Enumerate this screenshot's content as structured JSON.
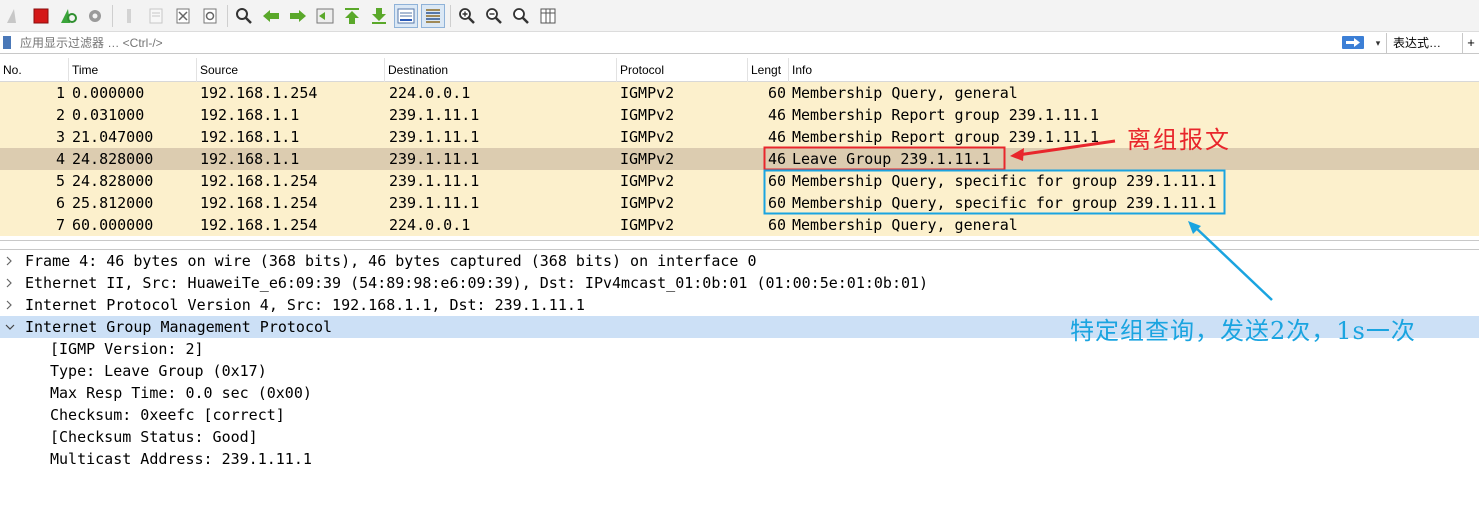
{
  "filter": {
    "placeholder": "应用显示过滤器 … <Ctrl-/>",
    "expression_label": "表达式…",
    "add_label": "+"
  },
  "toolbar": {
    "icons": [
      "shark-fin-start-icon",
      "stop-icon",
      "restart-icon",
      "options-gear-icon",
      "open-file-icon",
      "save-file-icon",
      "close-file-icon",
      "reload-icon",
      "find-icon",
      "go-back-icon",
      "go-forward-icon",
      "go-to-packet-icon",
      "first-packet-icon",
      "last-packet-icon",
      "autoscroll-icon",
      "colorize-icon",
      "zoom-in-icon",
      "zoom-out-icon",
      "zoom-reset-icon",
      "resize-columns-icon"
    ]
  },
  "columns": [
    "No.",
    "Time",
    "Source",
    "Destination",
    "Protocol",
    "Lengt",
    "Info"
  ],
  "packets": [
    {
      "no": "1",
      "time": "0.000000",
      "source": "192.168.1.254",
      "destination": "224.0.0.1",
      "protocol": "IGMPv2",
      "length": "60",
      "info": "Membership Query, general"
    },
    {
      "no": "2",
      "time": "0.031000",
      "source": "192.168.1.1",
      "destination": "239.1.11.1",
      "protocol": "IGMPv2",
      "length": "46",
      "info": "Membership Report group 239.1.11.1"
    },
    {
      "no": "3",
      "time": "21.047000",
      "source": "192.168.1.1",
      "destination": "239.1.11.1",
      "protocol": "IGMPv2",
      "length": "46",
      "info": "Membership Report group 239.1.11.1"
    },
    {
      "no": "4",
      "time": "24.828000",
      "source": "192.168.1.1",
      "destination": "239.1.11.1",
      "protocol": "IGMPv2",
      "length": "46",
      "info": "Leave Group 239.1.11.1"
    },
    {
      "no": "5",
      "time": "24.828000",
      "source": "192.168.1.254",
      "destination": "239.1.11.1",
      "protocol": "IGMPv2",
      "length": "60",
      "info": "Membership Query, specific for group 239.1.11.1"
    },
    {
      "no": "6",
      "time": "25.812000",
      "source": "192.168.1.254",
      "destination": "239.1.11.1",
      "protocol": "IGMPv2",
      "length": "60",
      "info": "Membership Query, specific for group 239.1.11.1"
    },
    {
      "no": "7",
      "time": "60.000000",
      "source": "192.168.1.254",
      "destination": "224.0.0.1",
      "protocol": "IGMPv2",
      "length": "60",
      "info": "Membership Query, general"
    }
  ],
  "details": {
    "frame": "Frame 4: 46 bytes on wire (368 bits), 46 bytes captured (368 bits) on interface 0",
    "ethernet": "Ethernet II, Src: HuaweiTe_e6:09:39 (54:89:98:e6:09:39), Dst: IPv4mcast_01:0b:01 (01:00:5e:01:0b:01)",
    "ip": "Internet Protocol Version 4, Src: 192.168.1.1, Dst: 239.1.11.1",
    "igmp": "Internet Group Management Protocol",
    "igmp_fields": [
      "[IGMP Version: 2]",
      "Type: Leave Group (0x17)",
      "Max Resp Time: 0.0 sec (0x00)",
      "Checksum: 0xeefc [correct]",
      "[Checksum Status: Good]",
      "Multicast Address: 239.1.11.1"
    ]
  },
  "annotations": {
    "leave_label": "离组报文",
    "query_label": "特定组查询，发送2次，1s一次",
    "red_color": "#e8262c",
    "blue_color": "#1aa4e0"
  },
  "colors": {
    "row_bg": "#fcf0cc",
    "selected_row_bg": "#dcccb0",
    "detail_highlight": "#cce0f6"
  }
}
